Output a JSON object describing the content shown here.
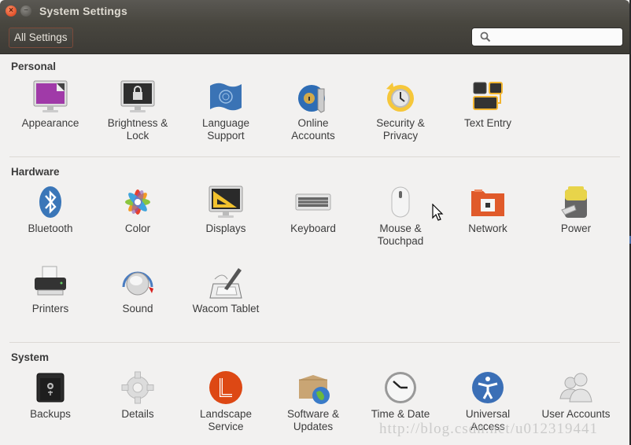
{
  "window": {
    "title": "System Settings",
    "close_label": "×",
    "minimize_label": "−"
  },
  "toolbar": {
    "all_settings_label": "All Settings",
    "search_placeholder": "",
    "search_value": ""
  },
  "sections": {
    "personal": {
      "title": "Personal",
      "items": [
        {
          "label": "Appearance",
          "icon": "appearance-icon"
        },
        {
          "label": "Brightness &\nLock",
          "icon": "brightness-lock-icon"
        },
        {
          "label": "Language\nSupport",
          "icon": "language-flag-icon"
        },
        {
          "label": "Online\nAccounts",
          "icon": "online-accounts-icon"
        },
        {
          "label": "Security &\nPrivacy",
          "icon": "security-privacy-icon"
        },
        {
          "label": "Text Entry",
          "icon": "text-entry-icon"
        }
      ]
    },
    "hardware": {
      "title": "Hardware",
      "items": [
        {
          "label": "Bluetooth",
          "icon": "bluetooth-icon"
        },
        {
          "label": "Color",
          "icon": "color-icon"
        },
        {
          "label": "Displays",
          "icon": "displays-icon"
        },
        {
          "label": "Keyboard",
          "icon": "keyboard-icon"
        },
        {
          "label": "Mouse &\nTouchpad",
          "icon": "mouse-icon"
        },
        {
          "label": "Network",
          "icon": "network-icon"
        },
        {
          "label": "Power",
          "icon": "power-battery-icon"
        },
        {
          "label": "Printers",
          "icon": "printer-icon"
        },
        {
          "label": "Sound",
          "icon": "sound-knob-icon"
        },
        {
          "label": "Wacom Tablet",
          "icon": "wacom-tablet-icon"
        }
      ]
    },
    "system": {
      "title": "System",
      "items": [
        {
          "label": "Backups",
          "icon": "backups-safe-icon"
        },
        {
          "label": "Details",
          "icon": "details-gear-icon"
        },
        {
          "label": "Landscape\nService",
          "icon": "landscape-icon"
        },
        {
          "label": "Software &\nUpdates",
          "icon": "software-updates-icon"
        },
        {
          "label": "Time & Date",
          "icon": "clock-icon"
        },
        {
          "label": "Universal\nAccess",
          "icon": "universal-access-icon"
        },
        {
          "label": "User Accounts",
          "icon": "user-accounts-icon"
        }
      ]
    }
  },
  "watermark": "http://blog.csdn.net/u012319441",
  "colors": {
    "titlebar": "#4f4d48",
    "content_bg": "#f2f1f0",
    "close_button": "#e2502a",
    "text": "#3c3c3c"
  }
}
